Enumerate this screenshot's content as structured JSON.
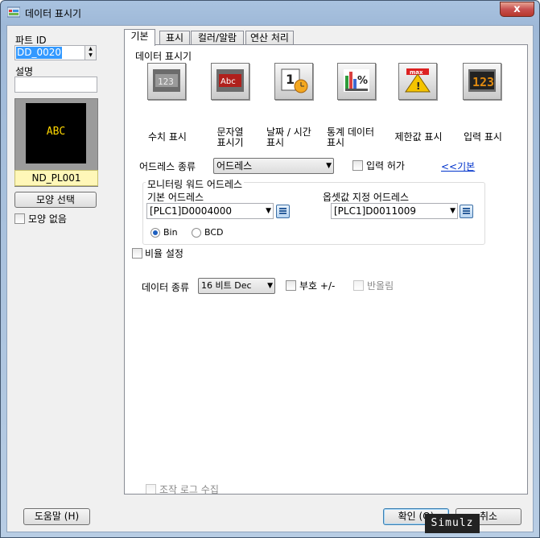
{
  "window": {
    "title": "데이터 표시기",
    "close_symbol": "x"
  },
  "left": {
    "part_id_label": "파트 ID",
    "part_id_value": "DD_0020",
    "description_label": "설명",
    "description_value": "",
    "preview_text": "ABC",
    "preview_name": "ND_PL001",
    "shape_select_button": "모양 선택",
    "no_shape_label": "모양 없음"
  },
  "tabs": [
    {
      "label": "기본",
      "active": true
    },
    {
      "label": "표시"
    },
    {
      "label": "컬러/알람"
    },
    {
      "label": "연산 처리"
    }
  ],
  "basic": {
    "section_title": "데이터 표시기",
    "display_types": [
      {
        "label": "수치 표시",
        "icon": "numeric-display-icon"
      },
      {
        "label": "문자열\n표시기",
        "icon": "string-display-icon"
      },
      {
        "label": "날짜 / 시간\n표시",
        "icon": "date-time-display-icon"
      },
      {
        "label": "통계 데이터\n표시",
        "icon": "statistics-display-icon"
      },
      {
        "label": "제한값 표시",
        "icon": "limit-value-display-icon"
      },
      {
        "label": "입력 표시",
        "icon": "input-display-icon"
      }
    ],
    "address_type_label": "어드레스 종류",
    "address_type_value": "어드레스",
    "allow_input_label": "입력 허가",
    "basic_link": "<<기본",
    "monitor_group_title": "모니터링 워드 어드레스",
    "base_address_label": "기본 어드레스",
    "base_address_value": "[PLC1]D0004000",
    "offset_address_label": "옵셋값 지정 어드레스",
    "offset_address_value": "[PLC1]D0011009",
    "radio_bin": "Bin",
    "radio_bcd": "BCD",
    "ratio_setting_label": "비율 설정",
    "data_type_label": "데이터 종류",
    "data_type_value": "16 비트 Dec",
    "sign_label": "부호 +/-",
    "rounding_label": "반올림",
    "operation_log_label": "조작 로그 수집"
  },
  "footer": {
    "help_button": "도움말 (H)",
    "ok_button": "확인 (O)",
    "cancel_button": "취소"
  },
  "watermark": "Simulz"
}
